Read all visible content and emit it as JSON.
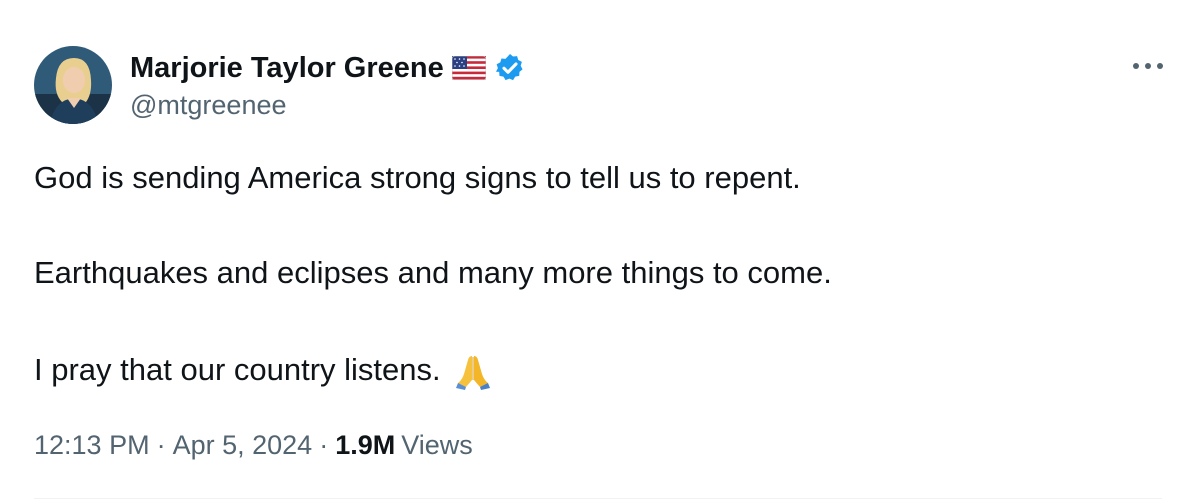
{
  "author": {
    "display_name": "Marjorie Taylor Greene",
    "handle": "@mtgreenee",
    "flag_icon": "us-flag-icon",
    "verified_icon": "verified-badge-icon",
    "verified_color": "#1d9bf0"
  },
  "tweet": {
    "line1": "God is sending America strong signs to tell us to repent.",
    "line2": "Earthquakes and eclipses and many more things to come.",
    "line3": "I pray that our country listens.",
    "emoji_icon": "praying-hands-icon"
  },
  "meta": {
    "time": "12:13 PM",
    "separator": "·",
    "date": "Apr 5, 2024",
    "views_count": "1.9M",
    "views_label": "Views"
  },
  "colors": {
    "text_primary": "#0f1419",
    "text_secondary": "#536471",
    "divider": "#eff3f4"
  },
  "more_icon": "more-options-icon"
}
